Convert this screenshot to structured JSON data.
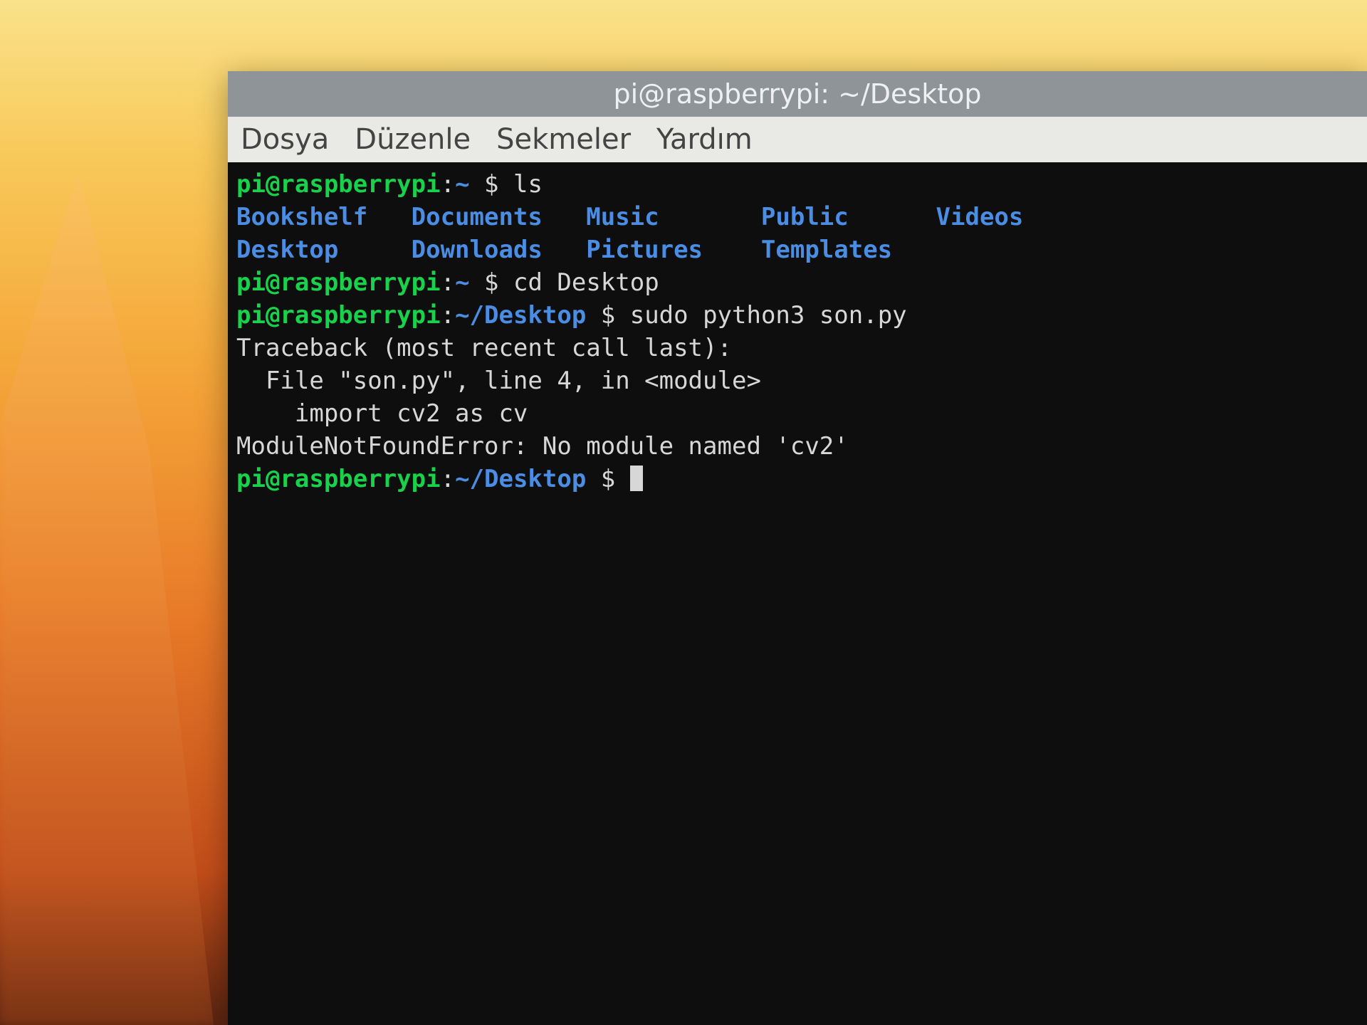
{
  "window": {
    "title": "pi@raspberrypi: ~/Desktop"
  },
  "menubar": {
    "items": [
      "Dosya",
      "Düzenle",
      "Sekmeler",
      "Yardım"
    ]
  },
  "colors": {
    "prompt_user": "#17d24a",
    "prompt_path": "#4a8de3",
    "dir_listing": "#4a8de3",
    "text": "#d7d7d7",
    "term_bg": "#0e0e0e",
    "titlebar_bg": "#8f9499",
    "menubar_bg": "#e9e9e6"
  },
  "terminal": {
    "lines": [
      {
        "type": "prompt",
        "user": "pi@raspberrypi",
        "path": "~",
        "cmd": "ls"
      },
      {
        "type": "ls-row",
        "cols": [
          "Bookshelf",
          "Documents",
          "Music",
          "Public",
          "Videos"
        ]
      },
      {
        "type": "ls-row",
        "cols": [
          "Desktop",
          "Downloads",
          "Pictures",
          "Templates",
          ""
        ]
      },
      {
        "type": "prompt",
        "user": "pi@raspberrypi",
        "path": "~",
        "cmd": "cd Desktop"
      },
      {
        "type": "prompt",
        "user": "pi@raspberrypi",
        "path": "~/Desktop",
        "cmd": "sudo python3 son.py"
      },
      {
        "type": "output",
        "text": "Traceback (most recent call last):"
      },
      {
        "type": "output",
        "text": "  File \"son.py\", line 4, in <module>"
      },
      {
        "type": "output",
        "text": "    import cv2 as cv"
      },
      {
        "type": "output",
        "text": "ModuleNotFoundError: No module named 'cv2'"
      },
      {
        "type": "prompt",
        "user": "pi@raspberrypi",
        "path": "~/Desktop",
        "cmd": "",
        "cursor": true
      }
    ],
    "ls_col_width": 12
  }
}
